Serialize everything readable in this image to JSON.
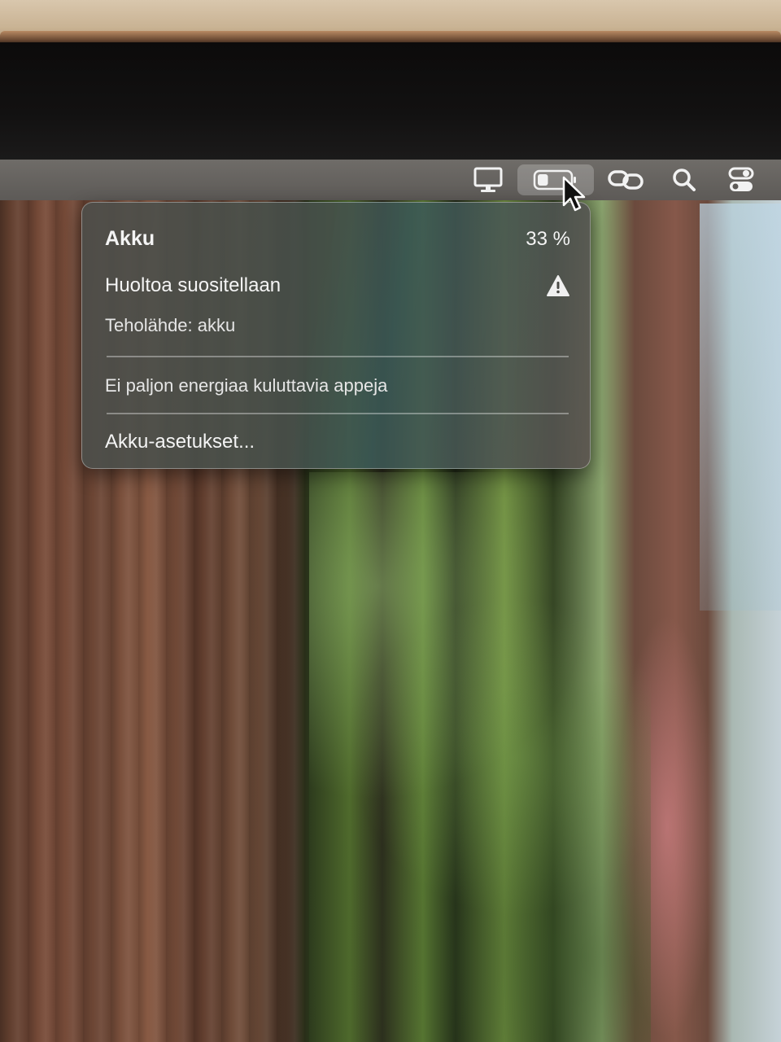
{
  "menubar": {
    "icons": [
      "display-icon",
      "battery-icon",
      "screen-mirroring-icon",
      "search-icon",
      "control-center-icon"
    ]
  },
  "battery_popover": {
    "title": "Akku",
    "percent": "33 %",
    "condition": "Huoltoa suositellaan",
    "power_source": "Teholähde: akku",
    "energy_apps": "Ei paljon energiaa kuluttavia appeja",
    "settings_link": "Akku-asetukset..."
  },
  "battery": {
    "level": 0.33
  }
}
